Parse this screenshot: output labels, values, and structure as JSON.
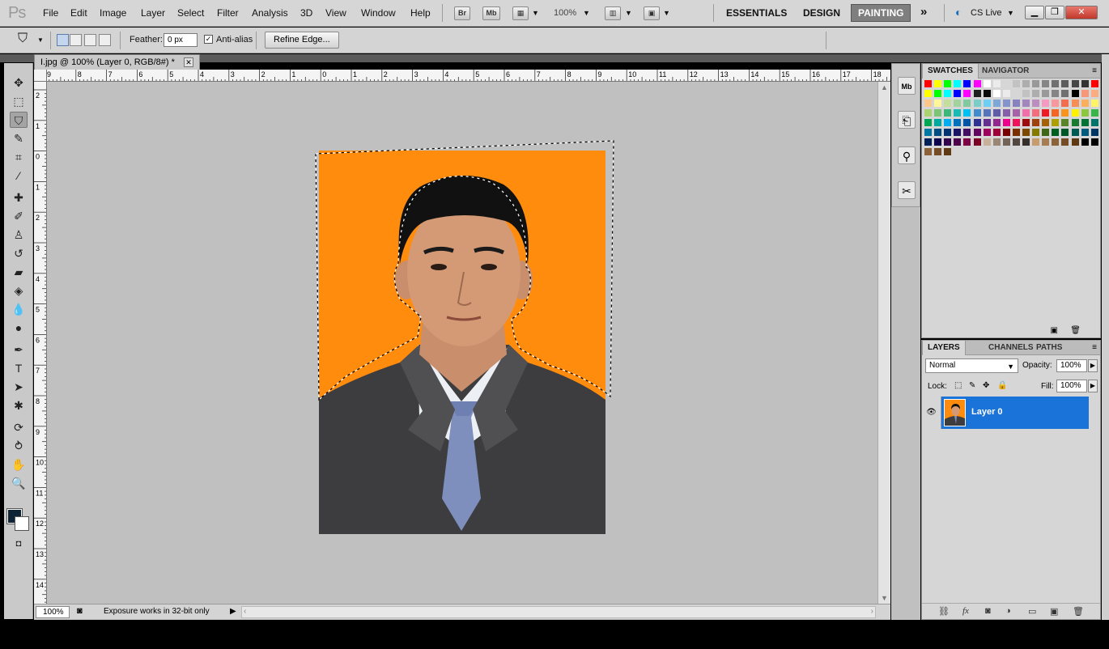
{
  "app": {
    "logo": "Ps"
  },
  "menu": [
    "File",
    "Edit",
    "Image",
    "Layer",
    "Select",
    "Filter",
    "Analysis",
    "3D",
    "View",
    "Window",
    "Help"
  ],
  "appbar": {
    "br": "Br",
    "mb": "Mb",
    "zoom": "100%"
  },
  "workspaces": {
    "essentials": "ESSENTIALS",
    "design": "DESIGN",
    "painting": "PAINTING",
    "more": "»",
    "cslive": "CS Live"
  },
  "options": {
    "feather_label": "Feather:",
    "feather_value": "0 px",
    "antialias_label": "Anti-alias",
    "antialias_checked": true,
    "refine_label": "Refine Edge..."
  },
  "document": {
    "tab_title": "I.jpg @ 100% (Layer 0, RGB/8#) *",
    "zoom": "100%",
    "status_msg": "Exposure works in 32-bit only"
  },
  "ruler_top": [
    "9",
    "8",
    "7",
    "6",
    "5",
    "4",
    "3",
    "2",
    "1",
    "0",
    "1",
    "2",
    "3",
    "4",
    "5",
    "6",
    "7",
    "8",
    "9",
    "10",
    "11",
    "12",
    "13",
    "14",
    "15",
    "16",
    "17",
    "18"
  ],
  "ruler_left": [
    "2",
    "1",
    "0",
    "1",
    "2",
    "3",
    "4",
    "5",
    "6",
    "7",
    "8",
    "9",
    "10",
    "11",
    "12",
    "13",
    "14"
  ],
  "colors": {
    "foreground": "#0e2436",
    "background": "#ffffff",
    "canvas_bg": "#ff8c0d"
  },
  "swatches_panel": {
    "tabs": [
      "SWATCHES",
      "NAVIGATOR"
    ]
  },
  "layers_panel": {
    "tabs": [
      "LAYERS",
      "CHANNELS",
      "PATHS"
    ],
    "blend_mode": "Normal",
    "opacity_label": "Opacity:",
    "opacity": "100%",
    "lock_label": "Lock:",
    "fill_label": "Fill:",
    "fill": "100%",
    "layers": [
      {
        "name": "Layer 0",
        "visible": true,
        "selected": true
      }
    ]
  }
}
